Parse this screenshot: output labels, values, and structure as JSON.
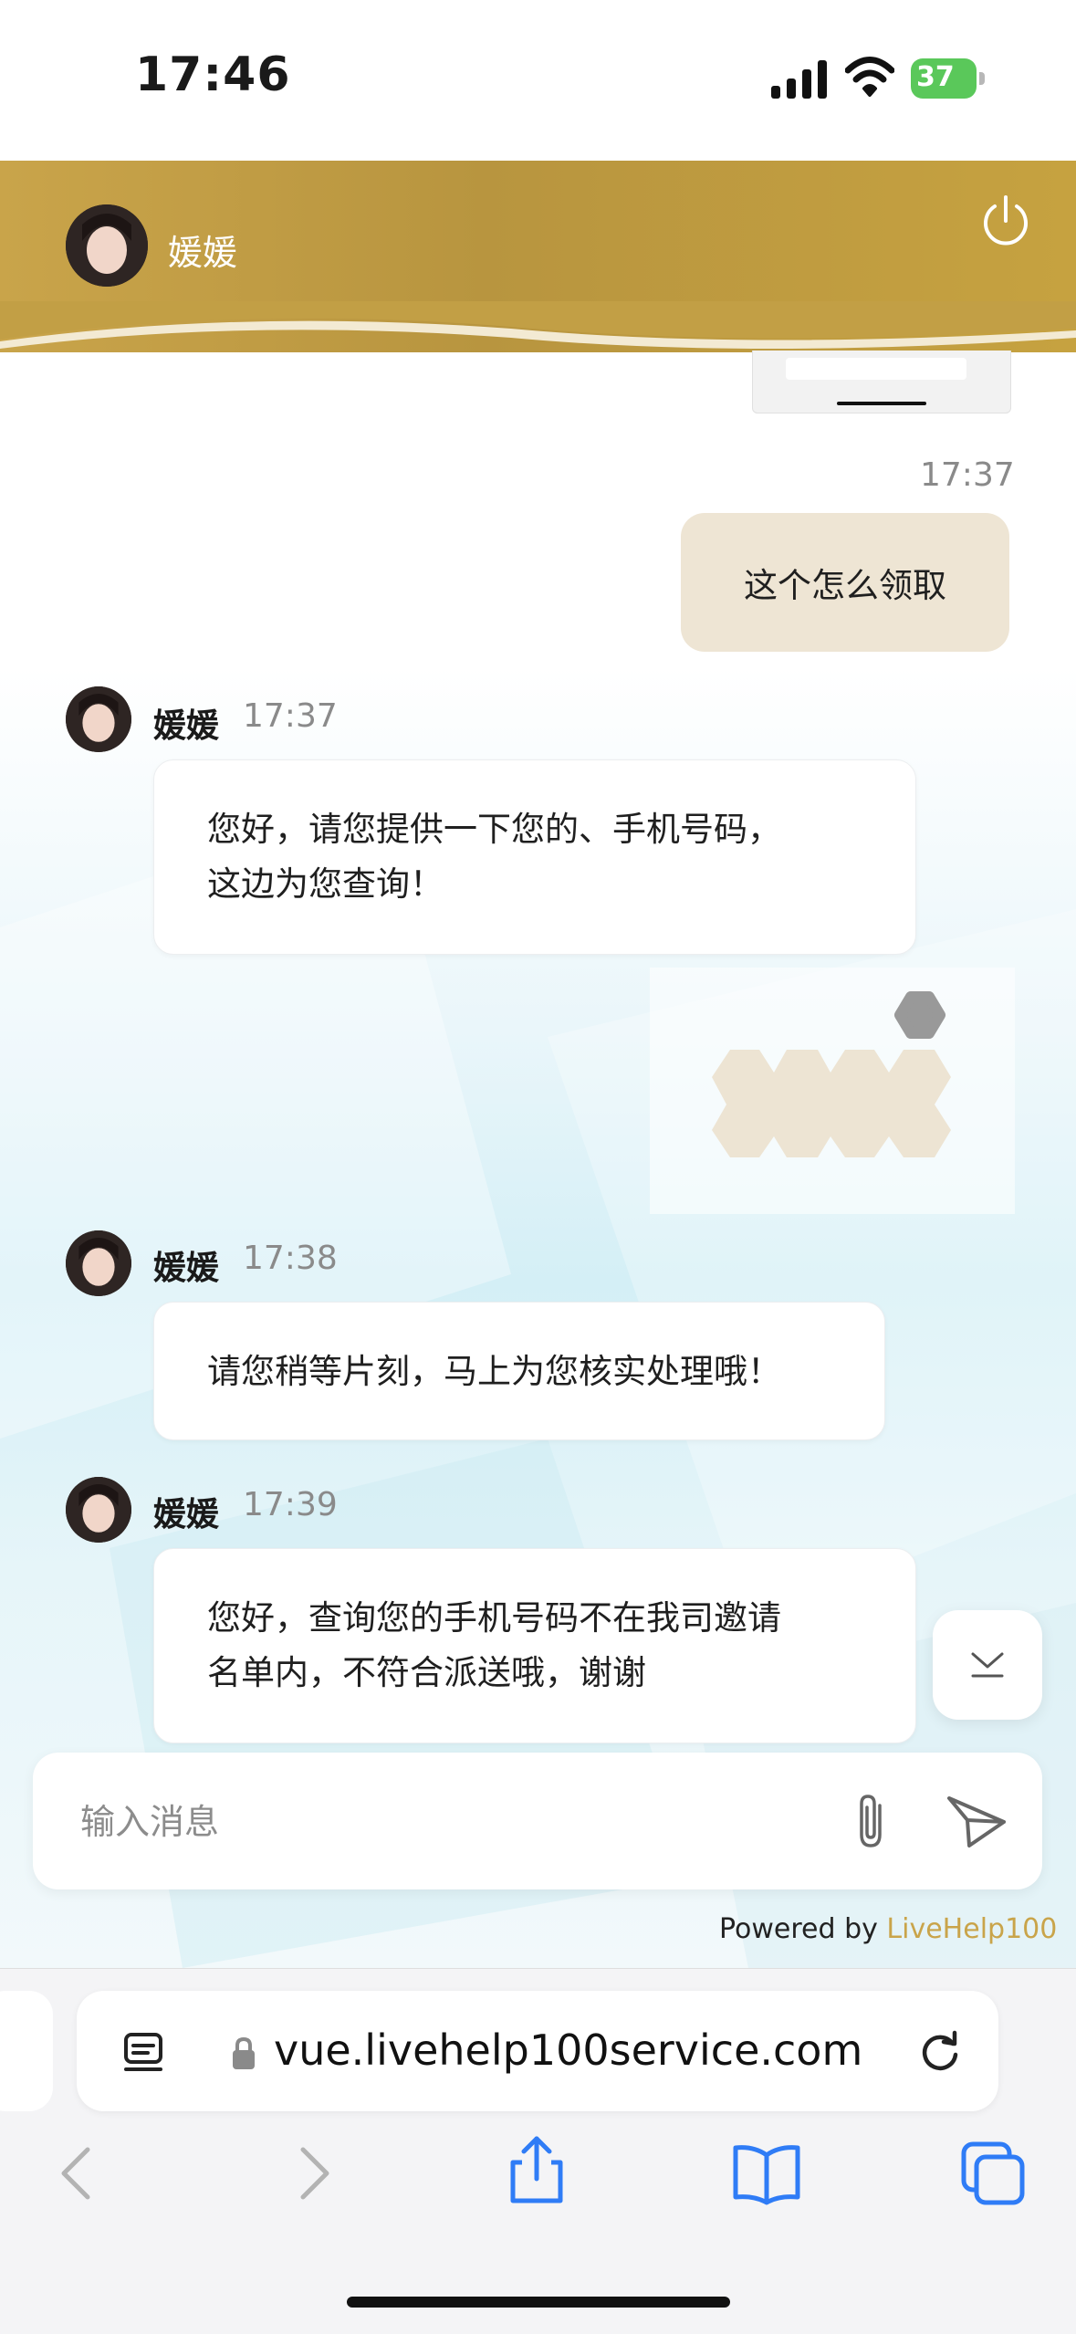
{
  "status_bar": {
    "time": "17:46",
    "battery": "37"
  },
  "header": {
    "agent_name": "媛媛"
  },
  "messages": [
    {
      "type": "outgoing",
      "time": "17:37",
      "text": "这个怎么领取"
    },
    {
      "type": "incoming",
      "sender": "媛媛",
      "time": "17:37",
      "lines": [
        "您好，请您提供一下您的、手机号码，",
        "这边为您查询！"
      ]
    },
    {
      "type": "outgoing-image"
    },
    {
      "type": "incoming",
      "sender": "媛媛",
      "time": "17:38",
      "lines": [
        "请您稍等片刻，马上为您核实处理哦！"
      ]
    },
    {
      "type": "incoming",
      "sender": "媛媛",
      "time": "17:39",
      "lines": [
        "您好，查询您的手机号码不在我司邀请",
        "名单内，不符合派送哦，谢谢"
      ]
    }
  ],
  "input": {
    "placeholder": "输入消息"
  },
  "footer": {
    "powered_prefix": "Powered by ",
    "powered_brand": "LiveHelp100"
  },
  "browser": {
    "url": "vue.livehelp100service.com"
  },
  "colors": {
    "header_gold": "#c9a44a",
    "outgoing_bubble": "#eee5d4",
    "battery_green": "#5ac85a",
    "safari_blue": "#2f7cf6"
  },
  "icons": [
    "signal-icon",
    "wifi-icon",
    "power-icon",
    "chevron-down-icon",
    "paperclip-icon",
    "send-icon",
    "reader-icon",
    "lock-icon",
    "reload-icon",
    "back-icon",
    "forward-icon",
    "share-icon",
    "bookmarks-icon",
    "tabs-icon"
  ]
}
